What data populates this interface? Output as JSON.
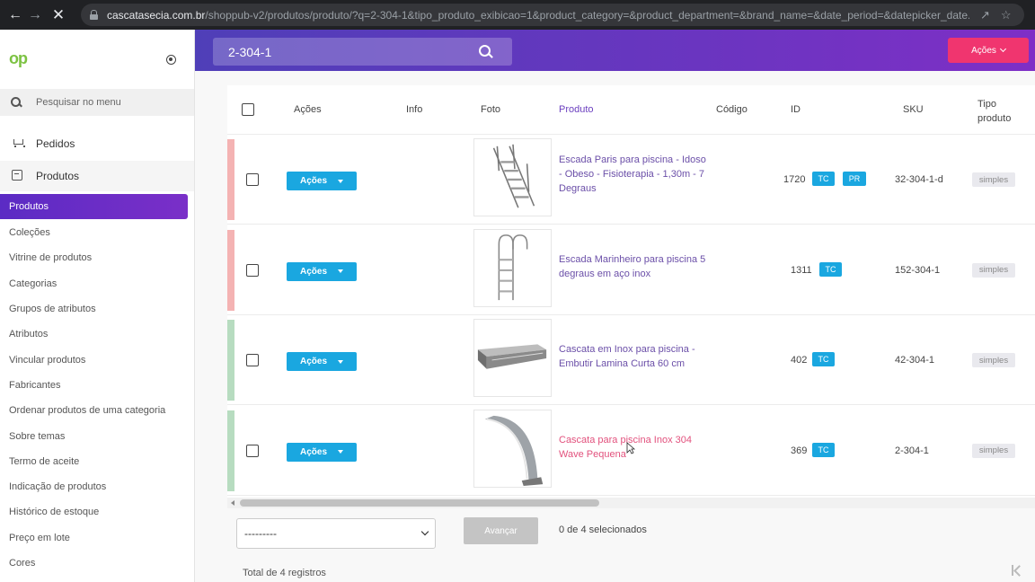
{
  "browser": {
    "url_host": "cascatasecia.com.br",
    "url_path": "/shoppub-v2/produtos/produto/?q=2-304-1&tipo_produto_exibicao=1&product_category=&product_department=&brand_name=&date_period=&datepicker_date..."
  },
  "sidebar": {
    "logo": "op",
    "search_placeholder": "Pesquisar no menu",
    "main_items": [
      {
        "label": "Pedidos",
        "icon": "cart-icon"
      },
      {
        "label": "Produtos",
        "icon": "box-icon"
      }
    ],
    "active_sub": "Produtos",
    "sub_items": [
      "Coleções",
      "Vitrine de produtos",
      "Categorias",
      "Grupos de atributos",
      "Atributos",
      "Vincular produtos",
      "Fabricantes",
      "Ordenar produtos de uma categoria",
      "Sobre temas",
      "Termo de aceite",
      "Indicação de produtos",
      "Histórico de estoque",
      "Preço em lote",
      "Cores"
    ]
  },
  "topbar": {
    "search_value": "2-304-1",
    "actions_label": "Ações"
  },
  "table": {
    "headers": {
      "acoes": "Ações",
      "info": "Info",
      "foto": "Foto",
      "produto": "Produto",
      "codigo": "Código",
      "id": "ID",
      "sku": "SKU",
      "tipo": "Tipo produto"
    },
    "rows": [
      {
        "status_color": "#f4b3b3",
        "action_label": "Ações",
        "photo": "ladder-paris",
        "name": "Escada Paris para piscina - Idoso - Obeso - Fisioterapia - 1,30m - 7 Degraus",
        "id": "1720",
        "tags": [
          "TC",
          "PR"
        ],
        "sku": "32-304-1-d",
        "tipo": "simples"
      },
      {
        "status_color": "#f4b3b3",
        "action_label": "Ações",
        "photo": "ladder-marinheiro",
        "name": "Escada Marinheiro para piscina 5 degraus em aço inox",
        "id": "1311",
        "tags": [
          "TC"
        ],
        "sku": "152-304-1",
        "tipo": "simples"
      },
      {
        "status_color": "#b7dcc0",
        "action_label": "Ações",
        "photo": "cascata-embutir",
        "name": "Cascata em Inox para piscina - Embutir Lamina Curta 60 cm",
        "id": "402",
        "tags": [
          "TC"
        ],
        "sku": "42-304-1",
        "tipo": "simples"
      },
      {
        "status_color": "#b7dcc0",
        "action_label": "Ações",
        "photo": "cascata-wave",
        "name": "Cascata para piscina Inox 304 Wave Pequena",
        "id": "369",
        "tags": [
          "TC"
        ],
        "sku": "2-304-1",
        "tipo": "simples"
      }
    ]
  },
  "footer": {
    "bulk_select_value": "---------",
    "advance_label": "Avançar",
    "selection_count": "0 de 4 selecionados",
    "total": "Total de 4 registros"
  }
}
